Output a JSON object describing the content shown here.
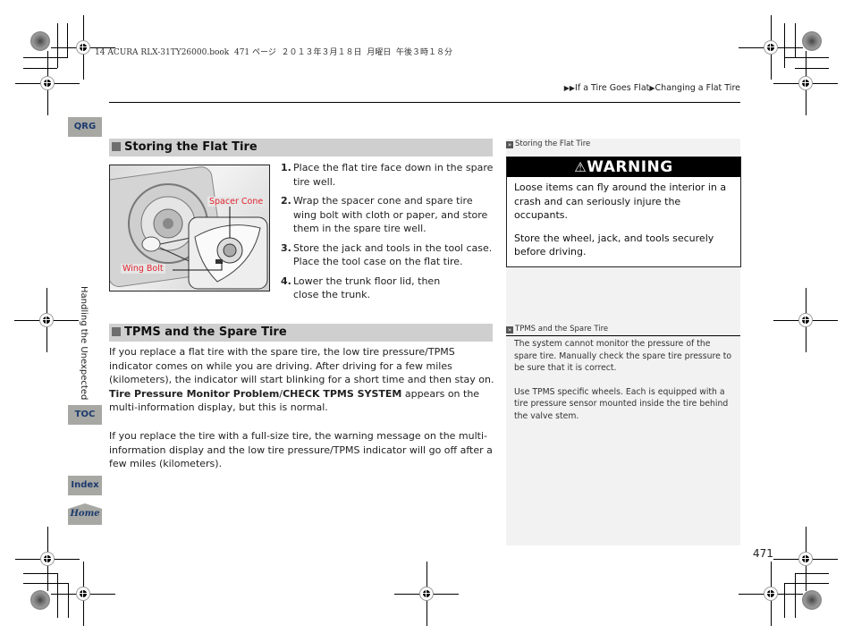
{
  "print_header": "14 ACURA RLX-31TY26000.book  471 ページ  ２０１３年３月１８日  月曜日  午後３時１８分",
  "breadcrumb": {
    "prefix_icon": "double-arrow-icon",
    "level1": "If a Tire Goes Flat",
    "separator_icon": "arrow-icon",
    "level2": "Changing a Flat Tire"
  },
  "nav": {
    "qrg": "QRG",
    "toc": "TOC",
    "index": "Index",
    "home": "Home"
  },
  "chapter_label": "Handling the Unexpected",
  "section1": {
    "title": "Storing the Flat Tire",
    "figure_callouts": {
      "spacer_cone": "Spacer Cone",
      "wing_bolt": "Wing Bolt"
    },
    "steps": [
      {
        "num": "1.",
        "text": "Place the flat tire face down in the spare tire well."
      },
      {
        "num": "2.",
        "text": "Wrap the spacer cone and spare tire wing bolt with cloth or paper, and store them in the spare tire well."
      },
      {
        "num": "3.",
        "text": "Store the jack and tools in the tool case. Place the tool case on the flat tire."
      },
      {
        "num": "4.",
        "text": "Lower the trunk floor lid, then close the trunk."
      }
    ]
  },
  "section2": {
    "title": "TPMS and the Spare Tire",
    "para1_a": "If you replace a flat tire with the spare tire, the low tire pressure/TPMS indicator comes on while you are driving. After driving for a few miles (kilometers), the indicator will start blinking for a short time and then stay on. ",
    "para1_bold1": "Tire Pressure Monitor Problem",
    "para1_slash": "/",
    "para1_bold2": "CHECK TPMS SYSTEM",
    "para1_b": " appears on the multi-information display, but this is normal.",
    "para2": "If you replace the tire with a full-size tire, the warning message on the multi-information display and the low tire pressure/TPMS indicator will go off after a few miles (kilometers)."
  },
  "sidebar": {
    "note1_title": "Storing the Flat Tire",
    "warning": {
      "label": "WARNING",
      "text1": "Loose items can fly around the interior in a crash and can seriously injure the occupants.",
      "text2": "Store the wheel, jack, and tools securely before driving."
    },
    "note2_title": "TPMS and the Spare Tire",
    "note2_p1": "The system cannot monitor the pressure of the spare tire. Manually check the spare tire pressure to be sure that it is correct.",
    "note2_p2": "Use TPMS specific wheels. Each is equipped with a tire pressure sensor mounted inside the tire behind the valve stem."
  },
  "page_number": "471",
  "colors": {
    "nav_tab_bg": "#a7a8a3",
    "nav_tab_text": "#1c3a6e",
    "section_header_bg": "#cfcfcf",
    "callout_red": "#e0242e",
    "sidebar_bg": "#f2f2f2"
  }
}
